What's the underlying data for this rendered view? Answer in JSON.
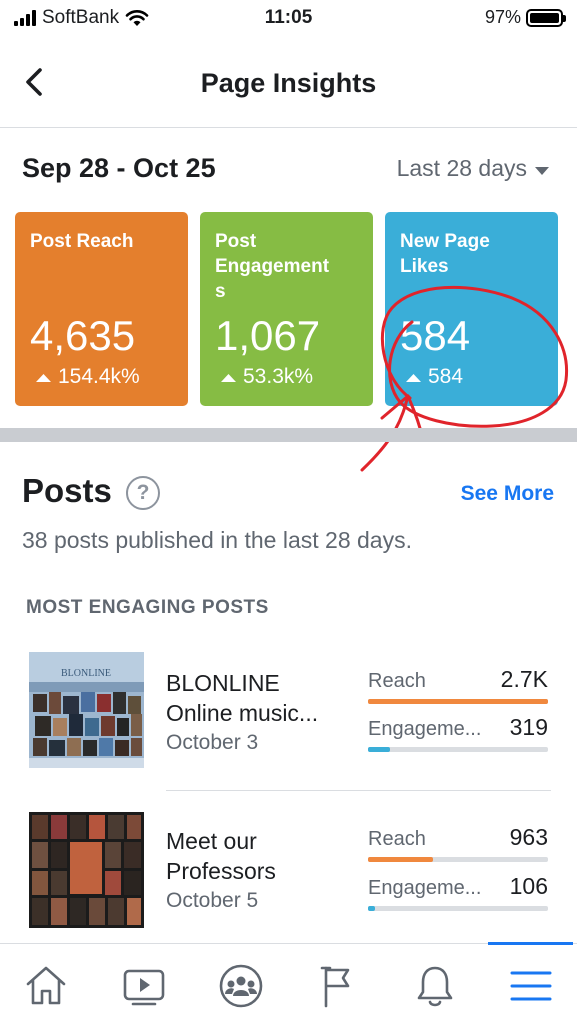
{
  "status_bar": {
    "carrier": "SoftBank",
    "time": "11:05",
    "battery": "97%"
  },
  "header": {
    "title": "Page Insights"
  },
  "date_range": "Sep 28 - Oct 25",
  "period_selector": "Last 28 days",
  "metrics": [
    {
      "label": "Post Reach",
      "value": "4,635",
      "delta": "154.4k%",
      "color": "#e47f2d"
    },
    {
      "label": "Post Engagement s",
      "label_lines": [
        "Post",
        "Engagement",
        "s"
      ],
      "value": "1,067",
      "delta": "53.3k%",
      "color": "#86bc44"
    },
    {
      "label": "New Page Likes",
      "label_lines": [
        "New Page",
        "Likes"
      ],
      "value": "584",
      "delta": "584",
      "color": "#3aaed8"
    }
  ],
  "posts": {
    "title": "Posts",
    "help": "?",
    "see_more": "See More",
    "subtitle": "38 posts published in the last 28 days.",
    "section_label": "MOST ENGAGING POSTS",
    "items": [
      {
        "title_lines": [
          "BLONLINE",
          "Online music..."
        ],
        "date": "October 3",
        "reach_label": "Reach",
        "reach_value": "2.7K",
        "reach_fraction": 1.0,
        "engagement_label": "Engageme...",
        "engagement_value": "319",
        "engagement_fraction": 0.12,
        "thumb_text": "BLONLINE"
      },
      {
        "title_lines": [
          "Meet our",
          "Professors"
        ],
        "date": "October 5",
        "reach_label": "Reach",
        "reach_value": "963",
        "reach_fraction": 0.36,
        "engagement_label": "Engageme...",
        "engagement_value": "106",
        "engagement_fraction": 0.04
      }
    ]
  },
  "colors": {
    "accent": "#1877f2",
    "reach_bar": "#f0883e",
    "engagement_bar": "#3aaed8",
    "annotation": "#e0242b"
  },
  "tabbar": {
    "tabs": [
      "home-icon",
      "video-icon",
      "groups-icon",
      "pages-flag-icon",
      "notifications-bell-icon",
      "menu-icon"
    ],
    "active": "menu-icon"
  }
}
